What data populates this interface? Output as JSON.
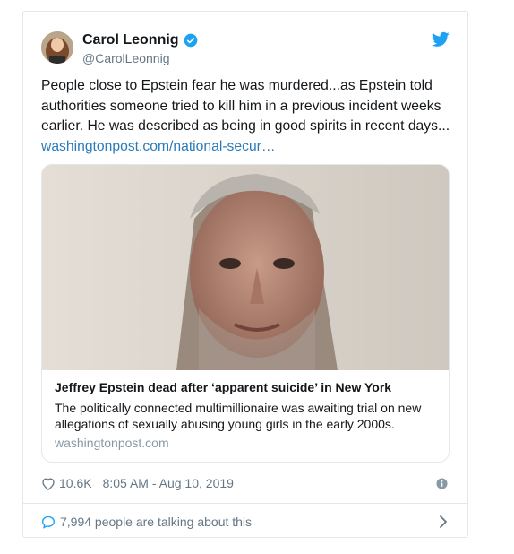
{
  "author": {
    "name": "Carol Leonnig",
    "handle": "@CarolLeonnig",
    "verified": true
  },
  "tweet": {
    "text": "People close to Epstein fear he was murdered...as Epstein told authorities someone tried to kill him in a previous incident weeks earlier. He was described as being in good spirits in recent days... ",
    "link_text": "washingtonpost.com/national-secur…"
  },
  "card": {
    "title": "Jeffrey Epstein dead after ‘apparent suicide’ in New York",
    "description": "The politically connected multimillionaire was awaiting trial on new allegations of sexually abusing young girls in the early 2000s.",
    "domain": "washingtonpost.com"
  },
  "meta": {
    "likes": "10.6K",
    "timestamp": "8:05 AM - Aug 10, 2019"
  },
  "conversation": {
    "text": "7,994 people are talking about this"
  },
  "icons": {
    "verified": "verified-badge-icon",
    "bird": "twitter-bird-icon",
    "like": "heart-icon",
    "info": "info-icon",
    "comment": "comment-icon",
    "chevron": "chevron-right-icon"
  },
  "colors": {
    "link": "#2b7bb9",
    "verified": "#1da1f2",
    "muted": "#657786",
    "border": "#e1e8ed"
  }
}
